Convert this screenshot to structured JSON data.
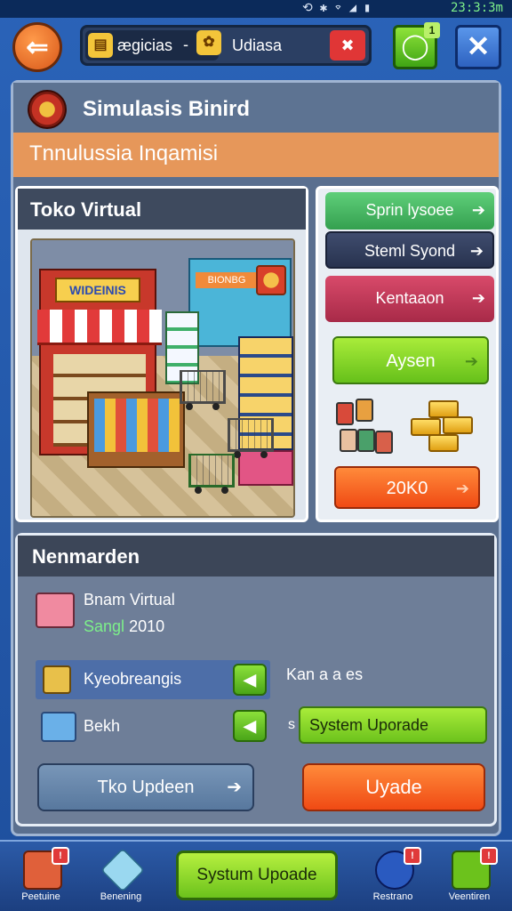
{
  "status_bar": {
    "time": "23:3:3m"
  },
  "top_bar": {
    "resource_chip_label": "ægicias",
    "resource_chip_dash": "-",
    "resource_label": "Udiasa",
    "green_badge": "1"
  },
  "header": {
    "title": "Simulasis Binird",
    "banner": "Tnnulussia Inqamisi"
  },
  "shop": {
    "title": "Toko Virtual",
    "sign": "WIDEINIS",
    "kiosk_sign": "BIONBG"
  },
  "menu": {
    "items": [
      {
        "label": "Sprin lysoee",
        "arrow": "➔"
      },
      {
        "label": "Steml Syond",
        "arrow": "➔"
      },
      {
        "label": "Kentaaon",
        "arrow": "➔"
      },
      {
        "label": "Aysen",
        "arrow": "➔"
      },
      {
        "label": "20K0",
        "arrow": "➔"
      }
    ]
  },
  "section2": {
    "title": "Nenmarden",
    "info_title": "Bnam Virtual",
    "info_sub_green": "Sangl",
    "info_sub_value": "2010",
    "row1_label": "Kyeobreangis",
    "row2_label": "Bekh",
    "kan_label": "Kan a a es",
    "s_dot": "s",
    "system_upgrade": "System Uporade",
    "tko_button": "Tko Updeen",
    "tko_arrow": "➔",
    "upgrade_button": "Uyade"
  },
  "navbar": {
    "items": [
      {
        "label": "Peetuine",
        "badge": "!"
      },
      {
        "label": "Benening"
      },
      {
        "label": "Restrano",
        "badge": "!"
      },
      {
        "label": "Veentiren",
        "badge": "!"
      }
    ],
    "center_button": "Systum Upoade"
  },
  "colors": {
    "accent_green": "#6cc21c",
    "accent_orange": "#f04a14",
    "banner_orange": "#e6975a",
    "panel_blue": "#5a6f8f"
  }
}
